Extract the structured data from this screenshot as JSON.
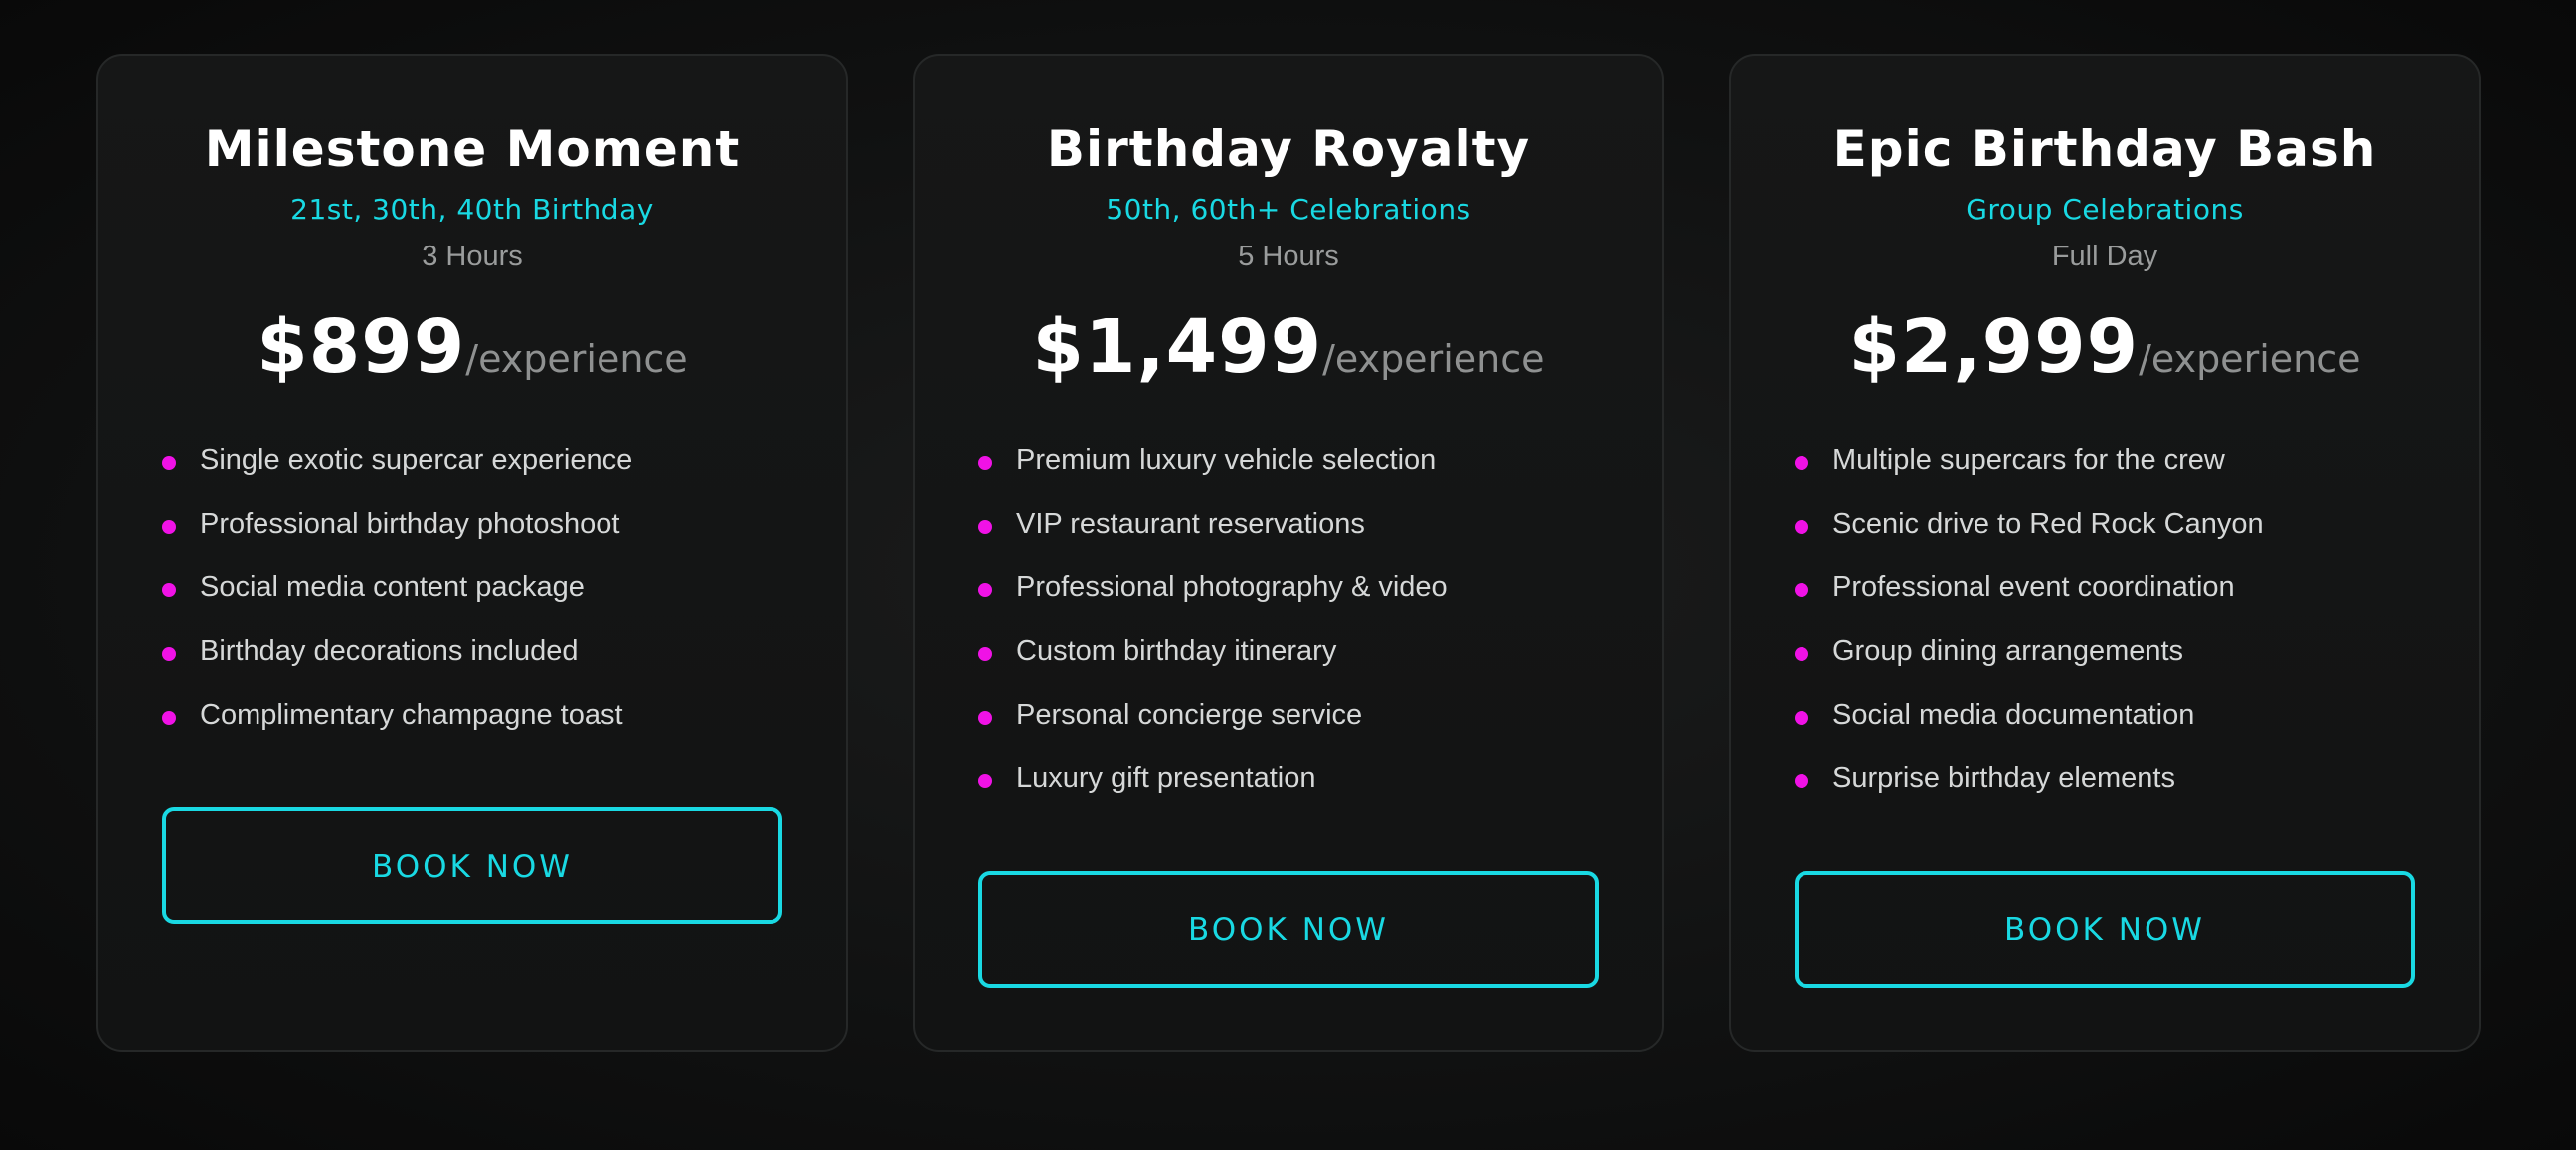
{
  "colors": {
    "accent_cyan": "#19d9e3",
    "bullet_magenta": "#f012e6",
    "card_bg": "#141515",
    "page_bg": "#0e0f0f"
  },
  "cards": [
    {
      "title": "Milestone Moment",
      "subtitle": "21st, 30th, 40th Birthday",
      "duration": "3 Hours",
      "price": "$899",
      "per": "/experience",
      "features": [
        "Single exotic supercar experience",
        "Professional birthday photoshoot",
        "Social media content package",
        "Birthday decorations included",
        "Complimentary champagne toast"
      ],
      "button": "BOOK NOW"
    },
    {
      "title": "Birthday Royalty",
      "subtitle": "50th, 60th+ Celebrations",
      "duration": "5 Hours",
      "price": "$1,499",
      "per": "/experience",
      "features": [
        "Premium luxury vehicle selection",
        "VIP restaurant reservations",
        "Professional photography & video",
        "Custom birthday itinerary",
        "Personal concierge service",
        "Luxury gift presentation"
      ],
      "button": "BOOK NOW"
    },
    {
      "title": "Epic Birthday Bash",
      "subtitle": "Group Celebrations",
      "duration": "Full Day",
      "price": "$2,999",
      "per": "/experience",
      "features": [
        "Multiple supercars for the crew",
        "Scenic drive to Red Rock Canyon",
        "Professional event coordination",
        "Group dining arrangements",
        "Social media documentation",
        "Surprise birthday elements"
      ],
      "button": "BOOK NOW"
    }
  ]
}
